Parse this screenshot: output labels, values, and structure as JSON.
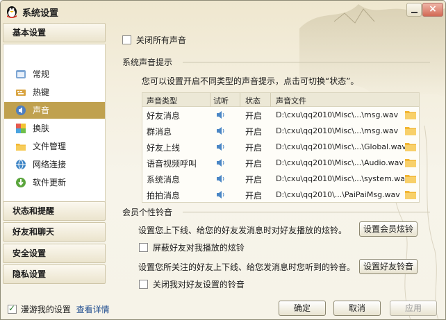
{
  "window": {
    "title": "系统设置"
  },
  "nav": {
    "section_basic": "基本设置",
    "items": [
      {
        "label": "常规",
        "icon": "general-icon"
      },
      {
        "label": "热键",
        "icon": "hotkey-icon"
      },
      {
        "label": "声音",
        "icon": "sound-icon",
        "active": true
      },
      {
        "label": "换肤",
        "icon": "skin-icon"
      },
      {
        "label": "文件管理",
        "icon": "folder-icon"
      },
      {
        "label": "网络连接",
        "icon": "network-icon"
      },
      {
        "label": "软件更新",
        "icon": "update-icon"
      }
    ],
    "section_status": "状态和提醒",
    "section_friends": "好友和聊天",
    "section_security": "安全设置",
    "section_privacy": "隐私设置"
  },
  "main": {
    "mute_all_label": "关闭所有声音",
    "system_sound_title": "系统声音提示",
    "system_sound_desc": "您可以设置开启不同类型的声音提示，点击可切换“状态”。",
    "table": {
      "headers": [
        "声音类型",
        "试听",
        "状态",
        "声音文件"
      ],
      "rows": [
        {
          "type": "好友消息",
          "status": "开启",
          "file": "D:\\cxu\\qq2010\\Misc\\...\\msg.wav"
        },
        {
          "type": "群消息",
          "status": "开启",
          "file": "D:\\cxu\\qq2010\\Misc\\...\\msg.wav"
        },
        {
          "type": "好友上线",
          "status": "开启",
          "file": "D:\\cxu\\qq2010\\Misc\\...\\Global.wav"
        },
        {
          "type": "语音视频呼叫",
          "status": "开启",
          "file": "D:\\cxu\\qq2010\\Misc\\...\\Audio.wav"
        },
        {
          "type": "系统消息",
          "status": "开启",
          "file": "D:\\cxu\\qq2010\\Misc\\...\\system.wav"
        },
        {
          "type": "拍拍消息",
          "status": "开启",
          "file": "D:\\cxu\\qq2010\\...\\PaiPaiMsg.wav"
        }
      ]
    },
    "member_title": "会员个性铃音",
    "member_desc": "设置您上下线、给您的好友发消息时对好友播放的炫铃。",
    "member_button": "设置会员炫铃",
    "block_label": "屏蔽好友对我播放的炫铃",
    "friend_desc": "设置您所关注的好友上下线、给您发消息时您听到的铃音。",
    "friend_button": "设置好友铃音",
    "close_friend_label": "关闭我对好友设置的铃音"
  },
  "footer": {
    "roam_label": "漫游我的设置",
    "details_link": "查看详情",
    "ok": "确定",
    "cancel": "取消",
    "apply": "应用"
  }
}
